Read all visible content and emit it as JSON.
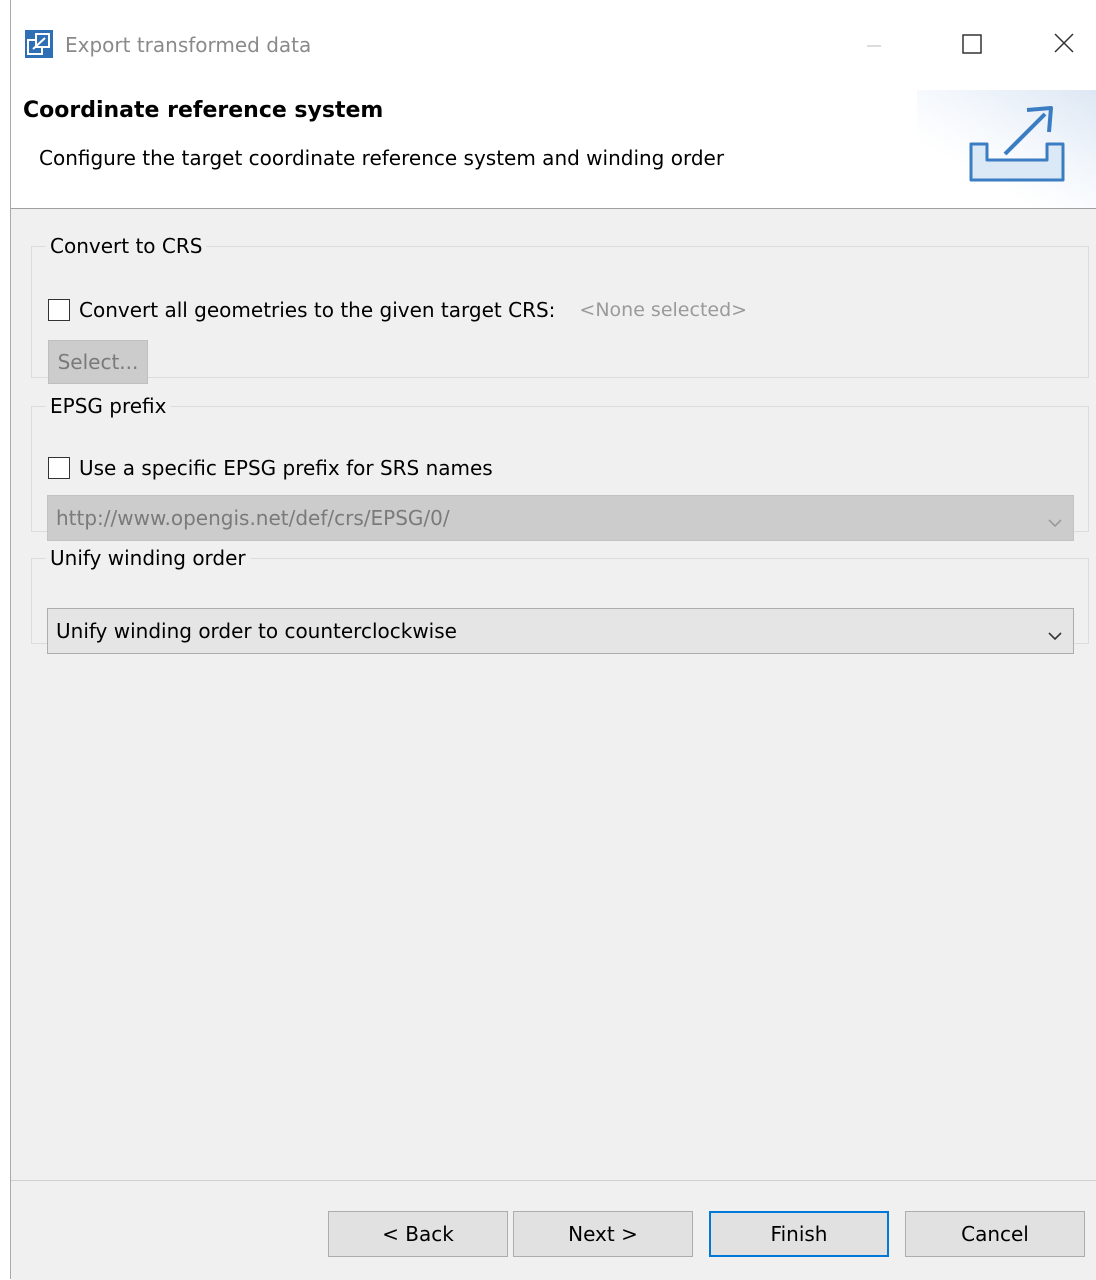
{
  "window": {
    "title": "Export transformed data"
  },
  "header": {
    "title": "Coordinate reference system",
    "description": "Configure the target coordinate reference system and winding order"
  },
  "convert_crs": {
    "legend": "Convert to CRS",
    "checkbox_label": "Convert all geometries to the given target CRS:",
    "checked": false,
    "selected_crs": "<None selected>",
    "select_button": "Select...",
    "select_enabled": false
  },
  "epsg": {
    "legend": "EPSG prefix",
    "checkbox_label": "Use a specific EPSG prefix for SRS names",
    "checked": false,
    "prefix_value": "http://www.opengis.net/def/crs/EPSG/0/",
    "enabled": false
  },
  "winding": {
    "legend": "Unify winding order",
    "value": "Unify winding order to counterclockwise"
  },
  "buttons": {
    "back": "< Back",
    "next": "Next >",
    "finish": "Finish",
    "cancel": "Cancel"
  },
  "icons": {
    "app": "export-app-icon",
    "header": "export-wizard-icon",
    "minimize": "minimize-icon",
    "maximize": "maximize-icon",
    "close": "close-icon",
    "dropdown": "chevron-down-icon"
  },
  "colors": {
    "accent": "#0078d7",
    "disabled_fill": "#cccccc",
    "window_bg": "#f0f0f0"
  }
}
